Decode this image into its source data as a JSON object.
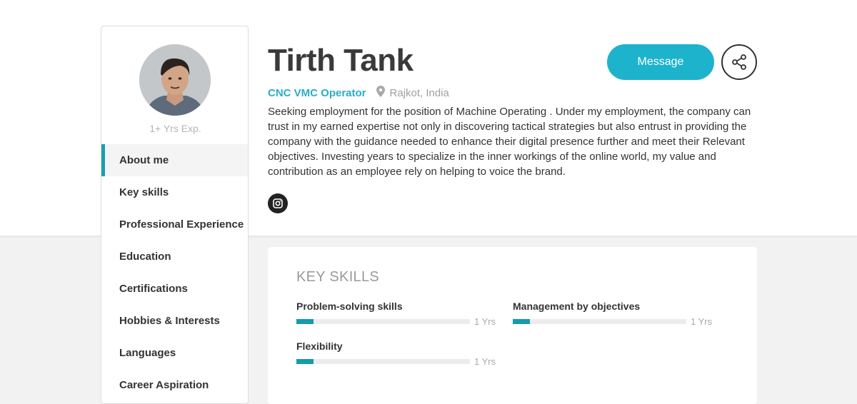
{
  "profile": {
    "name": "Tirth Tank",
    "role": "CNC VMC Operator",
    "location": "Rajkot, India",
    "experience": "1+ Yrs Exp.",
    "about": "Seeking employment for the position of Machine Operating . Under my employment, the company can trust in my earned expertise not only in discovering tactical strategies but also entrust in providing the company with the guidance needed to enhance their digital presence further and meet their Relevant objectives. Investing years to specialize in the inner workings of the online world, my value and contribution as an employee rely on helping to voice the brand."
  },
  "actions": {
    "message_label": "Message"
  },
  "sidebar": {
    "items": [
      {
        "label": "About me",
        "active": true
      },
      {
        "label": "Key skills",
        "active": false
      },
      {
        "label": "Professional Experience",
        "active": false
      },
      {
        "label": "Education",
        "active": false
      },
      {
        "label": "Certifications",
        "active": false
      },
      {
        "label": "Hobbies & Interests",
        "active": false
      },
      {
        "label": "Languages",
        "active": false
      },
      {
        "label": "Career Aspiration",
        "active": false
      }
    ]
  },
  "key_skills": {
    "title": "KEY SKILLS",
    "items": [
      {
        "name": "Problem-solving skills",
        "years": "1 Yrs",
        "level": 0.1
      },
      {
        "name": "Management by objectives",
        "years": "1 Yrs",
        "level": 0.1
      },
      {
        "name": "Flexibility",
        "years": "1 Yrs",
        "level": 0.1
      }
    ]
  },
  "icons": {
    "location": "map-pin-icon",
    "share": "share-icon",
    "social": "instagram-icon"
  },
  "colors": {
    "accent": "#1eb3cc",
    "role_text": "#2aaec4",
    "skill_bar": "#159bad",
    "active_nav_marker": "#1a9fb2"
  }
}
